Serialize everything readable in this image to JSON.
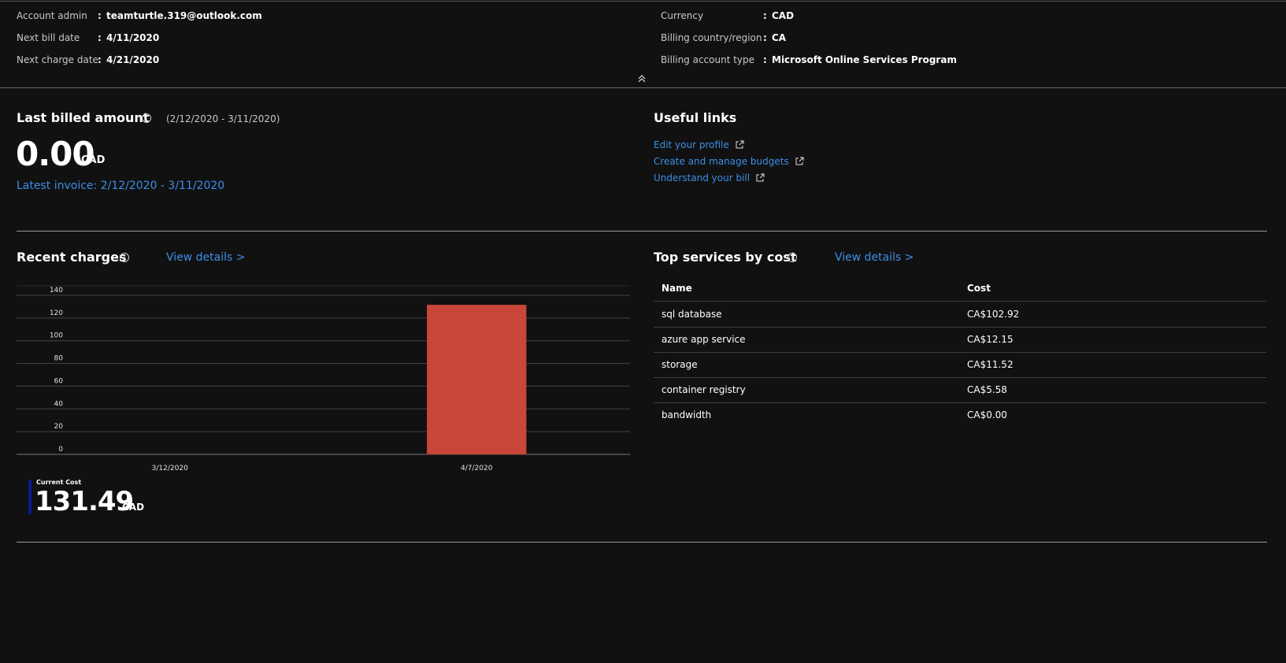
{
  "summary": {
    "left": [
      {
        "label": "Account admin",
        "value": "teamturtle.319@outlook.com"
      },
      {
        "label": "Next bill date",
        "value": "4/11/2020"
      },
      {
        "label": "Next charge date",
        "value": "4/21/2020"
      }
    ],
    "right": [
      {
        "label": "Currency",
        "value": "CAD"
      },
      {
        "label": "Billing country/region",
        "value": "CA"
      },
      {
        "label": "Billing account type",
        "value": "Microsoft Online Services Program"
      }
    ],
    "colon": ":"
  },
  "last_billed": {
    "title": "Last billed amount",
    "period": "(2/12/2020 - 3/11/2020)",
    "amount": "0.00",
    "currency": "CAD",
    "invoice_link": "Latest invoice: 2/12/2020 - 3/11/2020"
  },
  "useful_links": {
    "title": "Useful links",
    "links": [
      "Edit your profile",
      "Create and manage budgets",
      "Understand your bill"
    ]
  },
  "recent_charges": {
    "title": "Recent charges",
    "view_details": "View details >",
    "legend_label": "Current Cost",
    "legend_amount": "131.49",
    "legend_currency": "CAD",
    "colors": {
      "bar": "#c9473a",
      "legend_marker": "#0b1a8c"
    }
  },
  "chart_data": {
    "type": "bar",
    "categories": [
      "3/12/2020",
      "4/7/2020"
    ],
    "values": [
      0,
      131.49
    ],
    "ylim": [
      0,
      140
    ],
    "yticks": [
      0,
      20,
      40,
      60,
      80,
      100,
      120,
      140
    ],
    "grid": true
  },
  "top_services": {
    "title": "Top services by cost",
    "view_details": "View details >",
    "columns": [
      "Name",
      "Cost"
    ],
    "rows": [
      [
        "sql database",
        "CA$102.92"
      ],
      [
        "azure app service",
        "CA$12.15"
      ],
      [
        "storage",
        "CA$11.52"
      ],
      [
        "container registry",
        "CA$5.58"
      ],
      [
        "bandwidth",
        "CA$0.00"
      ]
    ]
  }
}
